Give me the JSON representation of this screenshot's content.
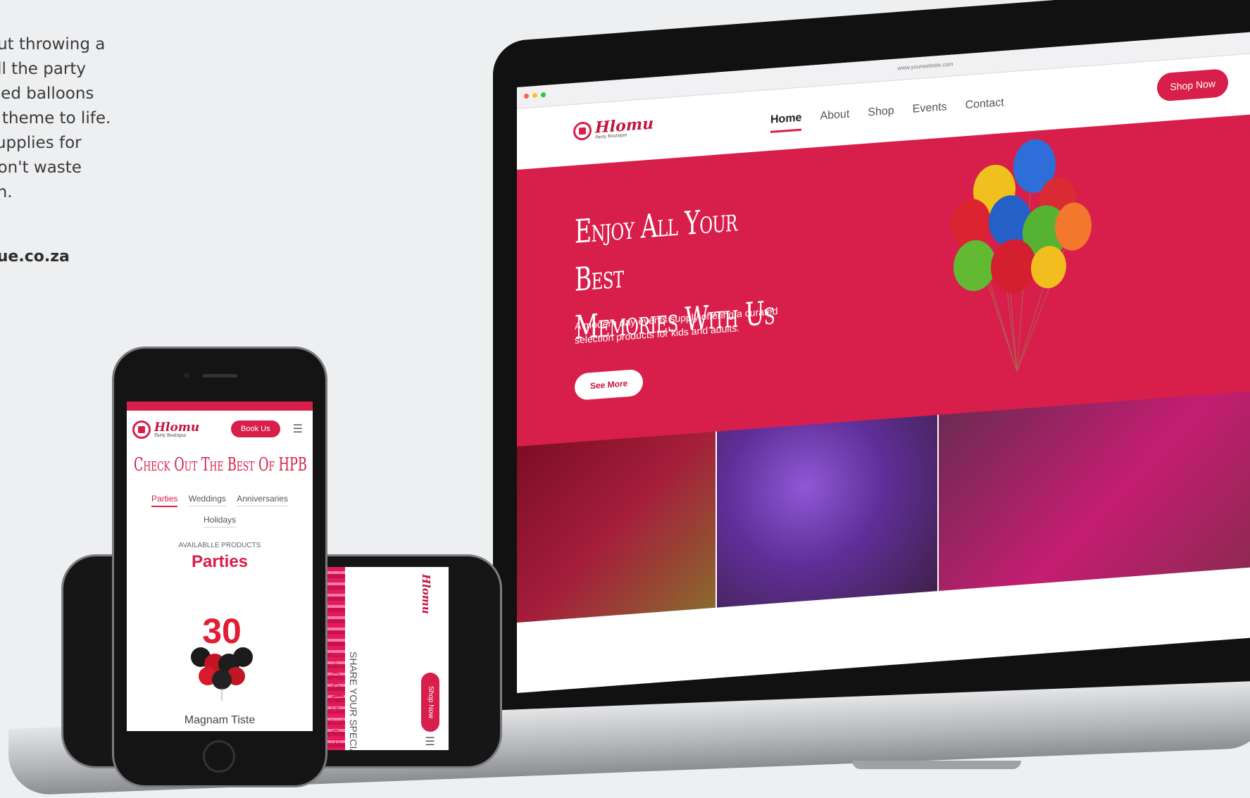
{
  "intro": {
    "lines": [
      "out throwing a",
      "all the party",
      "illed balloons",
      "y theme to life.",
      " supplies for",
      " don't waste",
      "vn."
    ],
    "url": "que.co.za"
  },
  "laptop_site": {
    "browser_address": "www.yourwebsite.com",
    "logo_name": "Hlomu",
    "logo_tagline": "Party Boutique",
    "nav": [
      "Home",
      "About",
      "Shop",
      "Events",
      "Contact"
    ],
    "nav_active": "Home",
    "shop_button": "Shop Now",
    "hero_title_line1": "Enjoy All Your Best",
    "hero_title_line2": "Memories With Us",
    "hero_text": "A modern day events supply offering a curated selection products for kids and adults.",
    "hero_button": "See More",
    "colors": {
      "brand_red": "#d81e4a",
      "text_dark": "#222222"
    }
  },
  "phone_vertical": {
    "logo_name": "Hlomu",
    "logo_tagline": "Party Boutique",
    "book_button": "Book Us",
    "menu_icon": "hamburger-icon",
    "title": "Check Out The Best Of HPB",
    "tabs": [
      "Parties",
      "Weddings",
      "Anniversaries",
      "Holidays"
    ],
    "active_tab": "Parties",
    "label": "AVAILABLLE PRODUCTS",
    "category": "Parties",
    "product_number": "30",
    "product_name": "Magnam Tiste"
  },
  "phone_horizontal": {
    "logo_name": "Hlomu",
    "subtitle": "SHARE YOUR SPECIAL MOMENT",
    "title": "Book Us For Any Occasion",
    "shop_button": "Shop Now",
    "menu_icon": "hamburger-icon"
  }
}
